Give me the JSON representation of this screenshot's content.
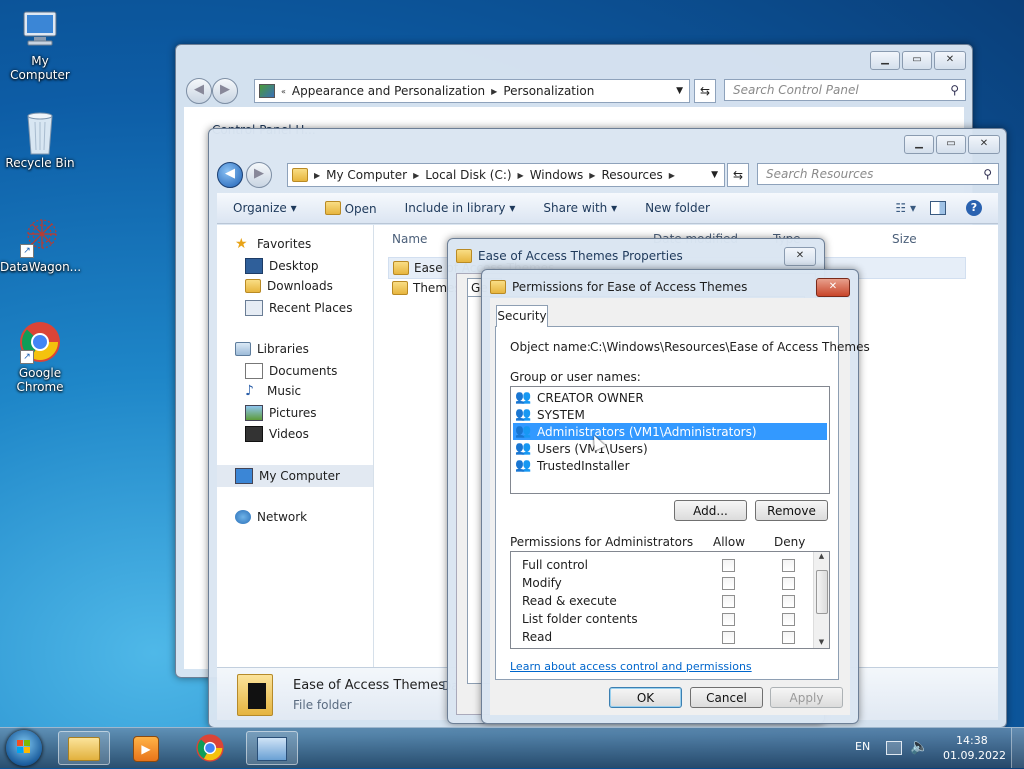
{
  "desktop": {
    "icons": [
      {
        "label": "My Computer",
        "icon": "computer-icon"
      },
      {
        "label": "Recycle Bin",
        "icon": "recycle-bin-icon"
      },
      {
        "label": "DataWagon...",
        "icon": "datawagon-icon"
      },
      {
        "label": "Google Chrome",
        "icon": "chrome-icon"
      }
    ]
  },
  "control_panel": {
    "breadcrumbs": [
      "Appearance and Personalization",
      "Personalization"
    ],
    "search_placeholder": "Search Control Panel",
    "partial_text": "Control Panel H..."
  },
  "explorer": {
    "breadcrumbs": [
      "My Computer",
      "Local Disk (C:)",
      "Windows",
      "Resources"
    ],
    "search_placeholder": "Search Resources",
    "toolbar": {
      "organize": "Organize",
      "open": "Open",
      "include": "Include in library",
      "share": "Share with",
      "new_folder": "New folder"
    },
    "nav": {
      "favorites": "Favorites",
      "desktop": "Desktop",
      "downloads": "Downloads",
      "recent": "Recent Places",
      "libraries": "Libraries",
      "documents": "Documents",
      "music": "Music",
      "pictures": "Pictures",
      "videos": "Videos",
      "computer": "My Computer",
      "network": "Network"
    },
    "columns": {
      "name": "Name",
      "date": "Date modified",
      "type": "Type",
      "size": "Size"
    },
    "files": [
      "Ease of Access Themes",
      "Themes"
    ],
    "details": {
      "name": "Ease of Access Themes",
      "type": "File folder",
      "date_label": "Da"
    }
  },
  "props_dialog": {
    "title": "Ease of Access Themes Properties",
    "tab_partial": "Ge"
  },
  "perm_dialog": {
    "title": "Permissions for Ease of Access Themes",
    "tab": "Security",
    "object_label": "Object name:",
    "object_value": "C:\\Windows\\Resources\\Ease of Access Themes",
    "group_label": "Group or user names:",
    "users": [
      "CREATOR OWNER",
      "SYSTEM",
      "Administrators (VM1\\Administrators)",
      "Users (VM1\\Users)",
      "TrustedInstaller"
    ],
    "selected_user": "Administrators (VM1\\Administrators)",
    "add": "Add...",
    "remove": "Remove",
    "permissions_label": "Permissions for Administrators",
    "allow": "Allow",
    "deny": "Deny",
    "permissions": [
      "Full control",
      "Modify",
      "Read & execute",
      "List folder contents",
      "Read"
    ],
    "link": "Learn about access control and permissions",
    "ok": "OK",
    "cancel": "Cancel",
    "apply": "Apply"
  },
  "taskbar": {
    "lang": "EN",
    "time": "14:38",
    "date": "01.09.2022"
  }
}
